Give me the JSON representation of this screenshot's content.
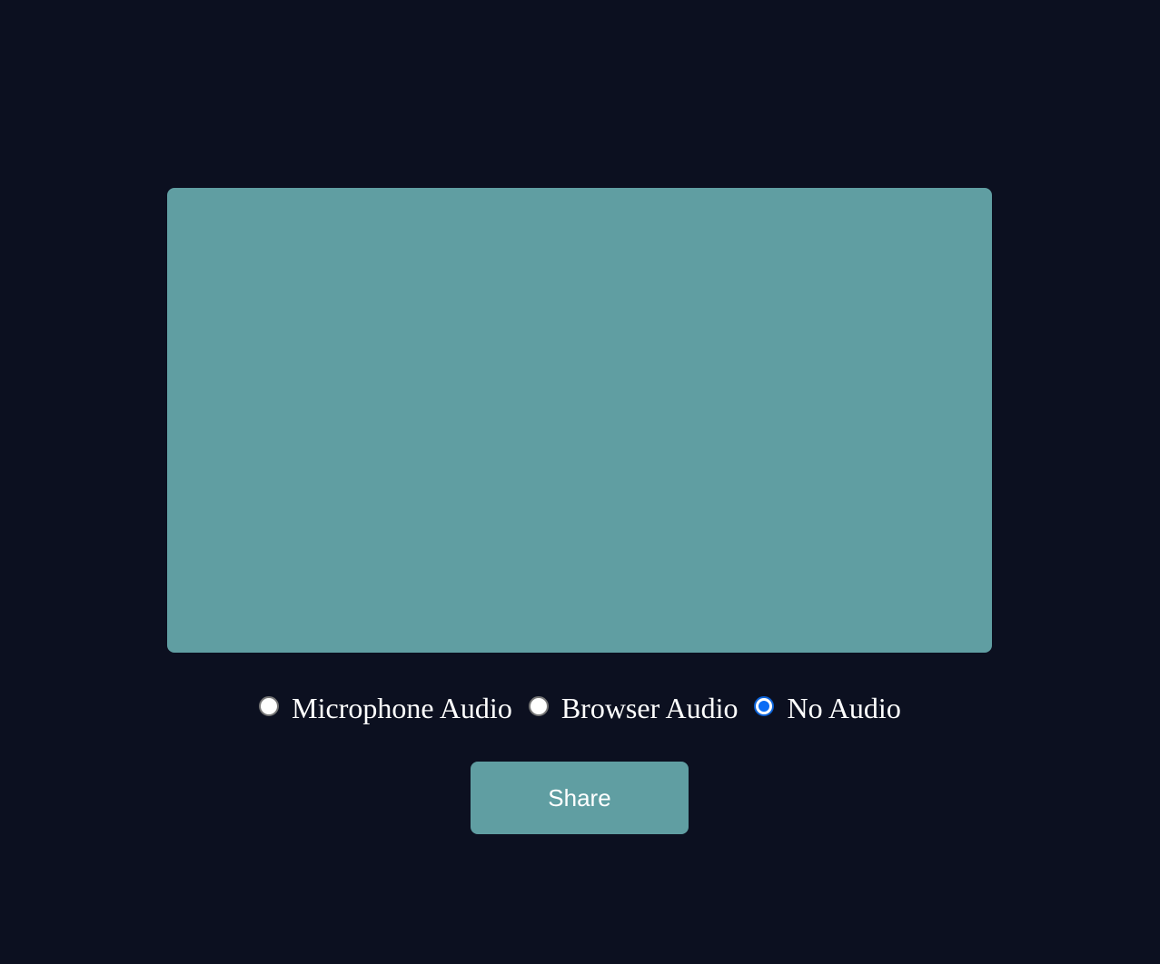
{
  "colors": {
    "background": "#0c1020",
    "accent": "#609ea2",
    "radio_selected": "#0a6cf5"
  },
  "preview": {
    "icon": "video-preview"
  },
  "audio_options": [
    {
      "label": "Microphone Audio",
      "selected": false
    },
    {
      "label": "Browser Audio",
      "selected": false
    },
    {
      "label": "No Audio",
      "selected": true
    }
  ],
  "share_button": {
    "label": "Share"
  }
}
